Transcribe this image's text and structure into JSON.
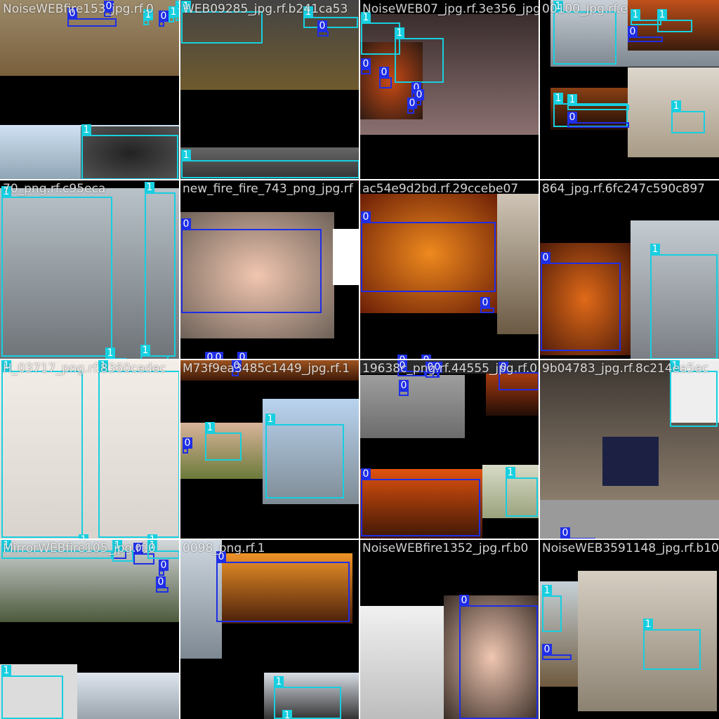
{
  "colors": {
    "fire_class": "#1f2ee6",
    "smoke_class": "#17cfe0",
    "padding": "#000000",
    "gray_pad": "#9a9a9a"
  },
  "class_labels": {
    "fire": "0",
    "smoke": "1"
  },
  "tiles": [
    {
      "title": "NoiseWEBfire153_jpg.rf.0",
      "boxes": [
        "0",
        "0",
        "1",
        "0",
        "1",
        "1",
        "1"
      ]
    },
    {
      "title": "WEB09285_jpg.rf.b241ca53",
      "boxes": [
        "1",
        "1",
        "0",
        "1"
      ]
    },
    {
      "title": "NoiseWEB07_jpg.rf.3e356_jpg.rf.f",
      "boxes": [
        "1",
        "1",
        "0",
        "0",
        "0",
        "0",
        "0"
      ]
    },
    {
      "title": "00100_jpg.rf.e",
      "boxes": [
        "1",
        "1",
        "1",
        "0",
        "1",
        "1",
        "0",
        "1"
      ]
    },
    {
      "title": "70_png.rf.c95eca",
      "boxes": [
        "1",
        "1",
        "1",
        "1"
      ]
    },
    {
      "title": "new_fire_fire_743_png_jpg.rf",
      "boxes": [
        "0",
        "0",
        "0",
        "0"
      ]
    },
    {
      "title": "ac54e9d2bd.rf.29ccebe07",
      "boxes": [
        "0",
        "0",
        "0",
        "0"
      ]
    },
    {
      "title": "864_jpg.rf.6fc247c590c897",
      "boxes": [
        "0",
        "1"
      ]
    },
    {
      "title": "H_03717_png.rf.8360cedec",
      "boxes": [
        "1",
        "1",
        "1",
        "1"
      ]
    },
    {
      "title": "M73f9ea3485c1449_jpg.rf.1",
      "boxes": [
        "0",
        "1",
        "1",
        "0"
      ]
    },
    {
      "title": "19638c_png.rf.44555_jpg.rf.0",
      "boxes": [
        "0",
        "0",
        "0",
        "0",
        "0",
        "0",
        "1"
      ]
    },
    {
      "title": "9b04783_jpg.rf.8c214ea5ec",
      "boxes": [
        "1",
        "0"
      ]
    },
    {
      "title": "MirrorWEBfire105_jpg.rf.0",
      "boxes": [
        "1",
        "0",
        "0",
        "0",
        "0",
        "1",
        "1",
        "1"
      ]
    },
    {
      "title": "0098_png.rf.1",
      "boxes": [
        "0",
        "1",
        "1"
      ]
    },
    {
      "title": "NoiseWEBfire1352_jpg.rf.b0",
      "boxes": [
        "0"
      ]
    },
    {
      "title": "NoiseWEB3591148_jpg.rf.b10",
      "boxes": [
        "1",
        "0",
        "0",
        "1"
      ]
    }
  ]
}
